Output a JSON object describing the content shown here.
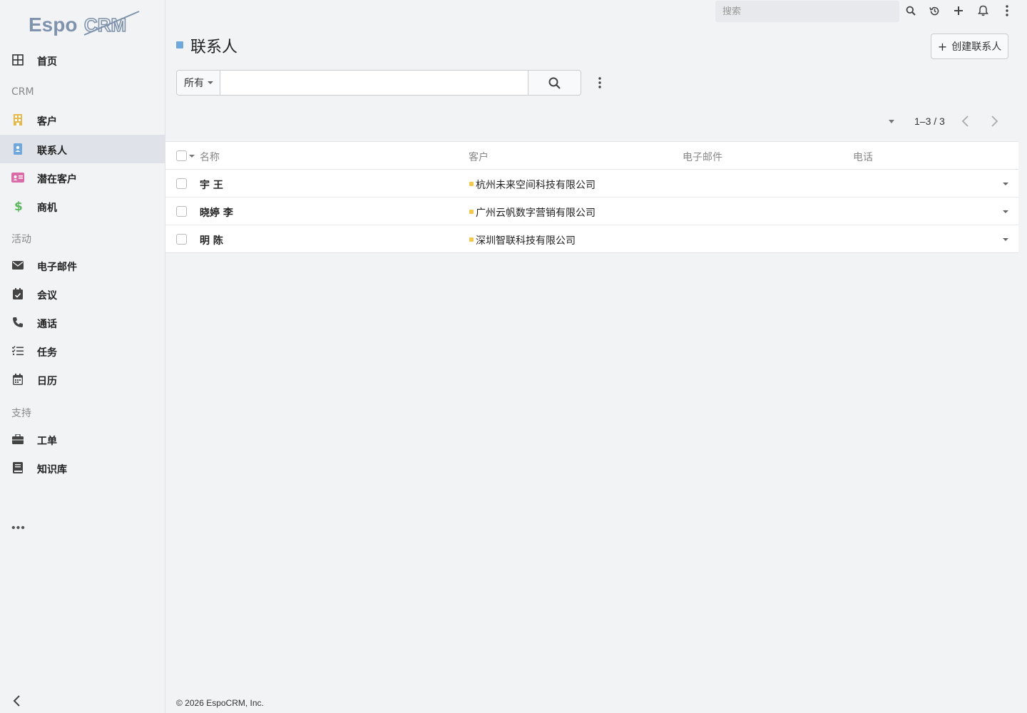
{
  "app": {
    "logo_text": "EspoCRM"
  },
  "sidebar": {
    "groups": [
      "CRM",
      "活动",
      "支持"
    ],
    "items": [
      {
        "label": "首页",
        "icon": "th-large-icon"
      },
      {
        "label": "客户",
        "icon": "building-icon",
        "color": "#e8b94a"
      },
      {
        "label": "联系人",
        "icon": "address-book-icon",
        "color": "#6fa8dc"
      },
      {
        "label": "潜在客户",
        "icon": "id-card-icon",
        "color": "#d96ca8"
      },
      {
        "label": "商机",
        "icon": "dollar-icon",
        "color": "#5cb85c"
      },
      {
        "label": "电子邮件",
        "icon": "envelope-icon"
      },
      {
        "label": "会议",
        "icon": "calendar-check-icon"
      },
      {
        "label": "通话",
        "icon": "phone-icon"
      },
      {
        "label": "任务",
        "icon": "tasks-icon"
      },
      {
        "label": "日历",
        "icon": "calendar-icon"
      },
      {
        "label": "工单",
        "icon": "briefcase-icon"
      },
      {
        "label": "知识库",
        "icon": "book-icon"
      }
    ],
    "more": "•••"
  },
  "topbar": {
    "search_placeholder": "搜索"
  },
  "header": {
    "title": "联系人",
    "create_label": "创建联系人"
  },
  "filter": {
    "selected": "所有",
    "query": ""
  },
  "pagination": {
    "range": "1–3 / 3"
  },
  "table": {
    "columns": [
      "名称",
      "客户",
      "电子邮件",
      "电话"
    ],
    "rows": [
      {
        "name": "宇 王",
        "account": "杭州未来空间科技有限公司",
        "email": "",
        "phone": ""
      },
      {
        "name": "晓婷 李",
        "account": "广州云帆数字营销有限公司",
        "email": "",
        "phone": ""
      },
      {
        "name": "明 陈",
        "account": "深圳智联科技有限公司",
        "email": "",
        "phone": ""
      }
    ]
  },
  "footer": {
    "copyright": "© 2026 EspoCRM, Inc."
  },
  "colors": {
    "accent": "#6fa8dc",
    "account_marker": "#f2c94c"
  }
}
